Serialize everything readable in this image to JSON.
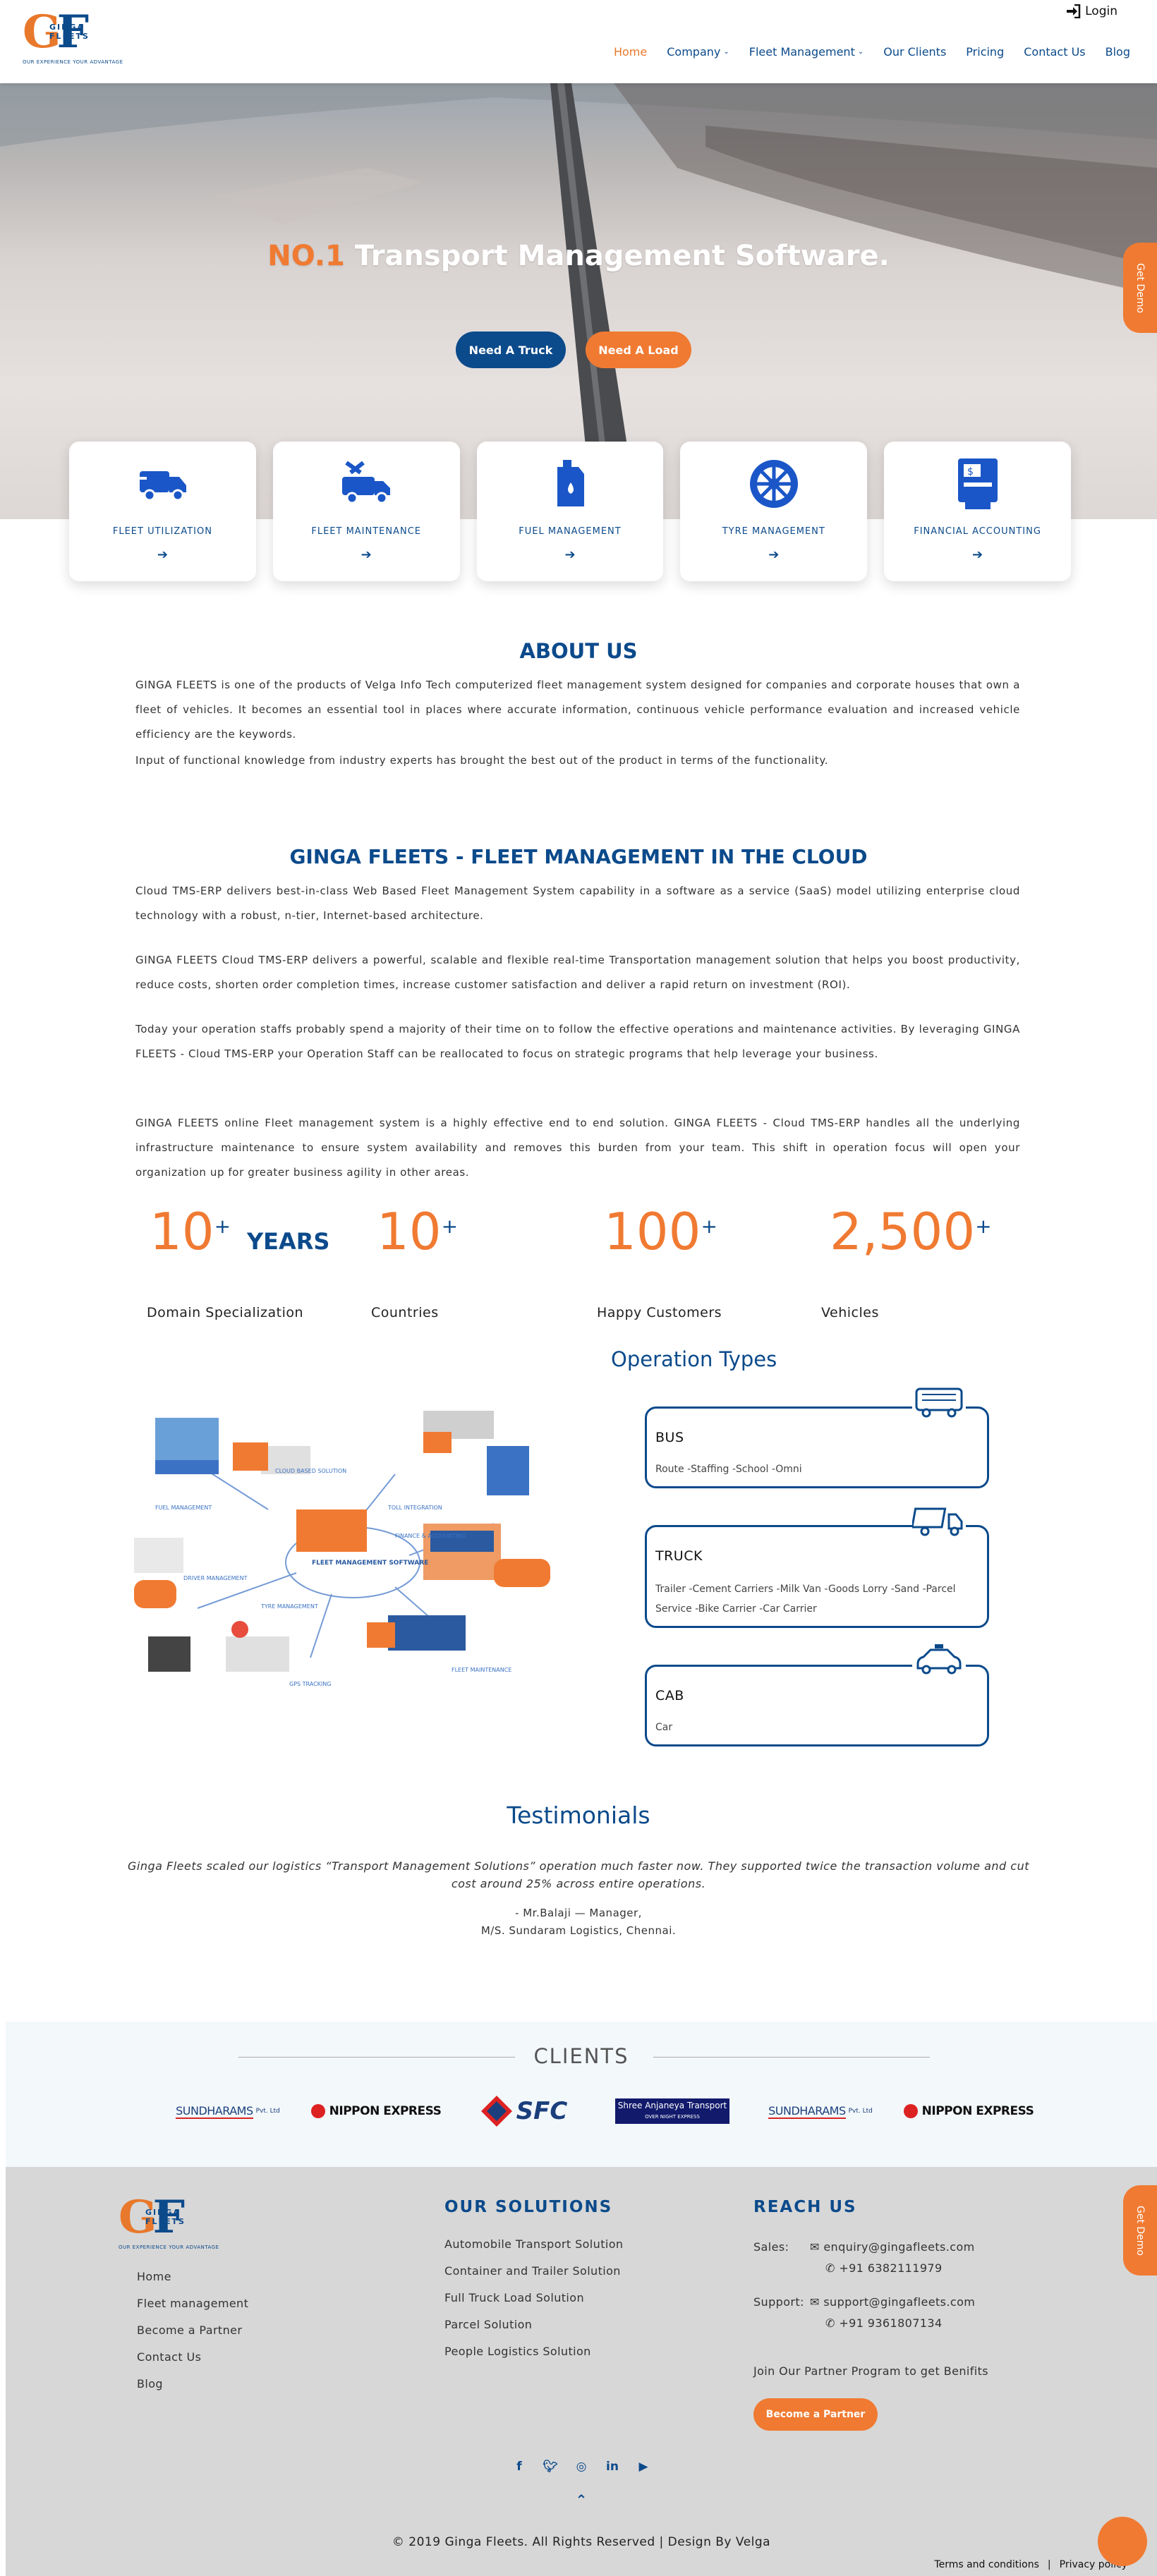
{
  "header": {
    "logo": {
      "letters": "GF",
      "brand": "GINGA FLEETS",
      "tagline": "OUR EXPERIENCE YOUR ADVANTAGE"
    },
    "login_label": "Login",
    "nav": [
      {
        "label": "Home"
      },
      {
        "label": "Company"
      },
      {
        "label": "Fleet Management"
      },
      {
        "label": "Our Clients"
      },
      {
        "label": "Pricing"
      },
      {
        "label": "Contact Us"
      },
      {
        "label": "Blog"
      }
    ]
  },
  "hero": {
    "title_highlight": "NO.1",
    "title_rest": "Transport Management Software.",
    "btn_truck": "Need A Truck",
    "btn_load": "Need A Load",
    "side_demo": "Get Demo"
  },
  "services": [
    {
      "label": "FLEET UTILIZATION",
      "icon": "truck-icon"
    },
    {
      "label": "FLEET MAINTENANCE",
      "icon": "wrench-truck-icon"
    },
    {
      "label": "FUEL MANAGEMENT",
      "icon": "fuel-can-icon"
    },
    {
      "label": "TYRE MANAGEMENT",
      "icon": "tyre-icon"
    },
    {
      "label": "FINANCIAL ACCOUNTING",
      "icon": "pos-terminal-icon"
    }
  ],
  "about": {
    "title": "ABOUT US",
    "p1": "GINGA FLEETS is one of the products of Velga Info Tech computerized fleet management system designed for companies and corporate houses that own a fleet of vehicles. It becomes an essential tool in places where accurate information, continuous vehicle performance evaluation and increased vehicle efficiency are the keywords.",
    "p2": "Input of functional knowledge from industry experts has brought the best out of the product in terms of the functionality."
  },
  "cloud": {
    "title": "GINGA FLEETS - FLEET MANAGEMENT IN THE CLOUD",
    "p1": "Cloud TMS-ERP delivers best-in-class Web Based Fleet Management System capability in a software as a service (SaaS) model utilizing enterprise cloud technology with a robust, n-tier, Internet-based architecture.",
    "p2": "GINGA FLEETS Cloud TMS-ERP delivers a powerful, scalable and flexible real-time Transportation management solution that helps you boost productivity, reduce costs, shorten order completion times, increase customer satisfaction and deliver a rapid return on investment (ROI).",
    "p3": "Today your operation staffs probably spend a majority of their time on to follow the effective operations and maintenance activities. By leveraging GINGA FLEETS - Cloud TMS-ERP your Operation Staff can be reallocated to focus on strategic programs that help leverage your business.",
    "p4": "GINGA FLEETS online Fleet management system is a highly effective end to end solution. GINGA FLEETS - Cloud TMS-ERP handles all the underlying infrastructure maintenance to ensure system availability and removes this burden from your team. This shift in operation focus will open your organization up for greater business agility in other areas."
  },
  "stats": [
    {
      "value": "10",
      "suffix": "+",
      "unit": "YEARS",
      "label": "Domain Specialization"
    },
    {
      "value": "10",
      "suffix": "+",
      "unit": "",
      "label": "Countries"
    },
    {
      "value": "100",
      "suffix": "+",
      "unit": "",
      "label": "Happy Customers"
    },
    {
      "value": "2,500",
      "suffix": "+",
      "unit": "",
      "label": "Vehicles"
    }
  ],
  "operations": {
    "title": "Operation Types",
    "items": [
      {
        "title": "BUS",
        "desc": "Route -Staffing -School -Omni",
        "icon": "bus-icon"
      },
      {
        "title": "TRUCK",
        "desc": "Trailer -Cement Carriers -Milk Van -Goods Lorry -Sand -Parcel Service -Bike Carrier -Car Carrier",
        "icon": "truck-outline-icon"
      },
      {
        "title": "CAB",
        "desc": "Car",
        "icon": "car-icon"
      }
    ],
    "illustration_labels": [
      "FUEL MANAGEMENT",
      "CLOUD BASED SOLUTION",
      "TOLL INTEGRATION",
      "FINANCE & ACCOUNTING",
      "FLEET MANAGEMENT SOFTWARE",
      "DRIVER MANAGEMENT",
      "TYRE MANAGEMENT",
      "FLEET MAINTENANCE",
      "GPS TRACKING"
    ]
  },
  "testimonials": {
    "title": "Testimonials",
    "quote": "Ginga Fleets scaled our logistics “Transport Management Solutions” operation much faster now. They supported twice the transaction volume and cut cost around 25% across entire operations.",
    "author": "- Mr.Balaji — Manager,",
    "company": "M/S. Sundaram Logistics, Chennai."
  },
  "clients": {
    "title": "CLIENTS",
    "logos": [
      {
        "name": "SUNDHARAMS",
        "suffix": "Pvt. Ltd"
      },
      {
        "name": "NIPPON EXPRESS"
      },
      {
        "name": "SFC"
      },
      {
        "name": "Shree Anjaneya Transport",
        "sub": "OVER NIGHT EXPRESS"
      },
      {
        "name": "SUNDHARAMS",
        "suffix": "Pvt. Ltd"
      },
      {
        "name": "NIPPON EXPRESS"
      }
    ]
  },
  "footer": {
    "links": [
      "Home",
      "Fleet management",
      "Become a Partner",
      "Contact Us",
      "Blog"
    ],
    "solutions_title": "OUR SOLUTIONS",
    "solutions": [
      "Automobile Transport Solution",
      "Container and Trailer Solution",
      "Full Truck Load Solution",
      "Parcel Solution",
      "People Logistics Solution"
    ],
    "reach_title": "REACH US",
    "sales_label": "Sales:",
    "sales_email": "enquiry@gingafleets.com",
    "sales_phone": "+91 6382111979",
    "support_label": "Support:",
    "support_email": "support@gingafleets.com",
    "support_phone": "+91 9361807134",
    "partner_text": "Join Our Partner Program to get Benifits",
    "partner_btn": "Become a Partner",
    "social": [
      "facebook-icon",
      "twitter-icon",
      "instagram-icon",
      "linkedin-icon",
      "youtube-icon"
    ],
    "copyright": "© 2019 Ginga Fleets. All Rights Reserved | Design By Velga",
    "terms": "Terms and conditions",
    "privacy": "Privacy policy"
  },
  "colors": {
    "brand_blue": "#0b4a8b",
    "brand_orange": "#f07a32",
    "footer_bg": "#d7d7d7"
  }
}
